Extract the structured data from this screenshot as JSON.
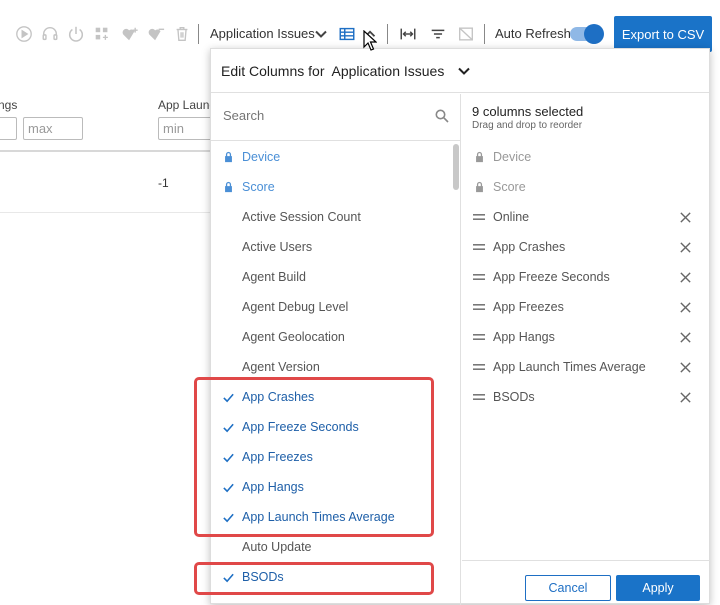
{
  "toolbar": {
    "icons": [
      "play-icon",
      "headset-icon",
      "power-icon",
      "grid-add-icon",
      "heart-add-icon",
      "heart-remove-icon",
      "trash-icon"
    ],
    "view_selector": "Application Issues",
    "auto_refresh_label": "Auto Refresh",
    "auto_refresh_on": true,
    "export_label": "Export to CSV"
  },
  "table": {
    "columns": [
      {
        "label": "ngs",
        "min_placeholder": "",
        "max_placeholder": "max"
      },
      {
        "label": "App Launc",
        "min_placeholder": "min"
      }
    ],
    "row_values": [
      "-1"
    ]
  },
  "panel": {
    "title": "Edit Columns for",
    "view_name": "Application Issues",
    "search_placeholder": "Search",
    "available": [
      {
        "label": "Device",
        "state": "locked"
      },
      {
        "label": "Score",
        "state": "locked"
      },
      {
        "label": "Active Session Count",
        "state": "none"
      },
      {
        "label": "Active Users",
        "state": "none"
      },
      {
        "label": "Agent Build",
        "state": "none"
      },
      {
        "label": "Agent Debug Level",
        "state": "none"
      },
      {
        "label": "Agent Geolocation",
        "state": "none"
      },
      {
        "label": "Agent Version",
        "state": "none"
      },
      {
        "label": "App Crashes",
        "state": "checked"
      },
      {
        "label": "App Freeze Seconds",
        "state": "checked"
      },
      {
        "label": "App Freezes",
        "state": "checked"
      },
      {
        "label": "App Hangs",
        "state": "checked"
      },
      {
        "label": "App Launch Times Average",
        "state": "checked"
      },
      {
        "label": "Auto Update",
        "state": "none"
      },
      {
        "label": "BSODs",
        "state": "checked"
      }
    ],
    "selected_count_label": "9 columns selected",
    "selected_hint": "Drag and drop to reorder",
    "selected": [
      {
        "label": "Device",
        "locked": true
      },
      {
        "label": "Score",
        "locked": true
      },
      {
        "label": "Online",
        "locked": false
      },
      {
        "label": "App Crashes",
        "locked": false
      },
      {
        "label": "App Freeze Seconds",
        "locked": false
      },
      {
        "label": "App Freezes",
        "locked": false
      },
      {
        "label": "App Hangs",
        "locked": false
      },
      {
        "label": "App Launch Times Average",
        "locked": false
      },
      {
        "label": "BSODs",
        "locked": false
      }
    ],
    "cancel_label": "Cancel",
    "apply_label": "Apply"
  },
  "colors": {
    "accent": "#1a73c8",
    "highlight": "#e04848"
  }
}
